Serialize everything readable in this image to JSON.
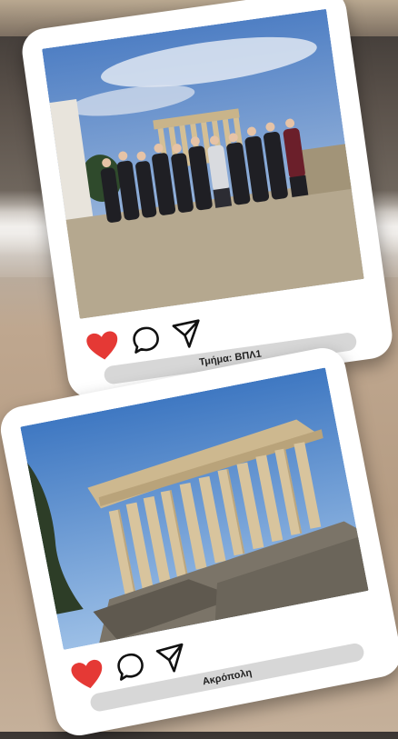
{
  "posts": [
    {
      "caption": "Τμήμα: ΒΠΛ1",
      "photo_subject": "group-photo-at-parthenon",
      "icons": [
        "heart-icon",
        "comment-icon",
        "share-icon"
      ]
    },
    {
      "caption": "Ακρόπολη",
      "photo_subject": "parthenon-temple",
      "icons": [
        "heart-icon",
        "comment-icon",
        "share-icon"
      ]
    }
  ],
  "colors": {
    "heart": "#e53935",
    "card": "#ffffff",
    "pill": "#d7d7d7"
  }
}
